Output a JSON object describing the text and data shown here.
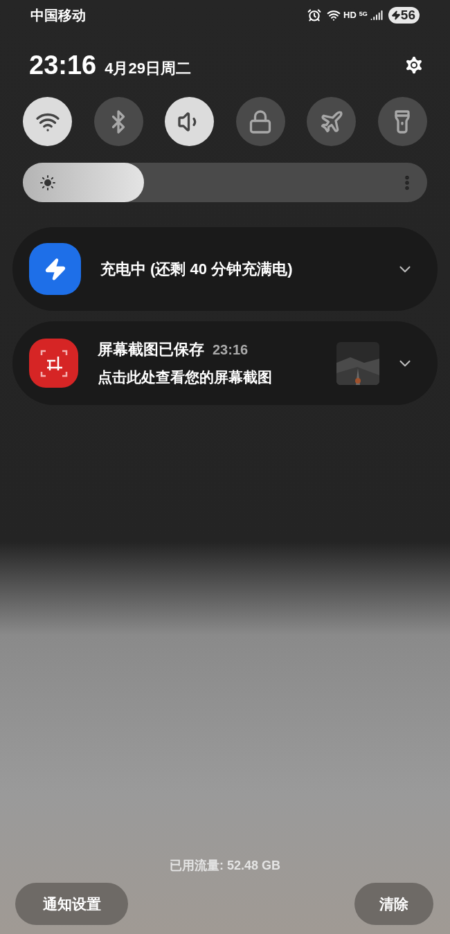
{
  "status_bar": {
    "carrier": "中国移动",
    "hd": "HD",
    "network": "5G",
    "battery": "56"
  },
  "header": {
    "time": "23:16",
    "date": "4月29日周二"
  },
  "toggles": [
    {
      "kind": "wifi",
      "on": true
    },
    {
      "kind": "bluetooth",
      "on": false
    },
    {
      "kind": "sound",
      "on": true
    },
    {
      "kind": "lock",
      "on": false
    },
    {
      "kind": "airplane",
      "on": false
    },
    {
      "kind": "flashlight",
      "on": false
    }
  ],
  "brightness": {
    "level": 0.3
  },
  "notifications": [
    {
      "kind": "charging",
      "title": "充电中 (还剩 40 分钟充满电)"
    },
    {
      "kind": "screenshot",
      "title": "屏幕截图已保存",
      "time": "23:16",
      "text": "点击此处查看您的屏幕截图"
    }
  ],
  "footer": {
    "data_usage": "已用流量: 52.48 GB",
    "buttons": [
      "通知设置",
      "清除"
    ]
  }
}
